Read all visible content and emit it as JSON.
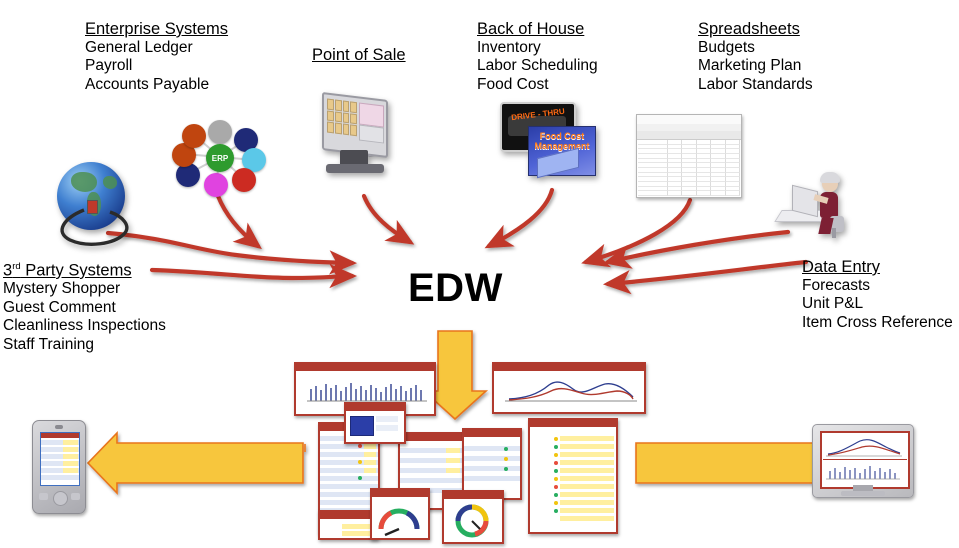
{
  "diagram": {
    "center_node": "EDW",
    "sources": [
      {
        "id": "enterprise-systems",
        "heading": "Enterprise Systems",
        "items": [
          "General Ledger",
          "Payroll",
          "Accounts Payable"
        ],
        "icon": "erp-bubble-chart-icon"
      },
      {
        "id": "point-of-sale",
        "heading": "Point of Sale",
        "items": [],
        "icon": "pos-terminal-icon"
      },
      {
        "id": "back-of-house",
        "heading": "Back of House",
        "items": [
          "Inventory",
          "Labor Scheduling",
          "Food Cost"
        ],
        "icon": "drive-thru-food-cost-icon"
      },
      {
        "id": "spreadsheets",
        "heading": "Spreadsheets",
        "items": [
          "Budgets",
          "Marketing Plan",
          "Labor Standards"
        ],
        "icon": "spreadsheet-window-icon"
      },
      {
        "id": "third-party-systems",
        "heading": "3rd Party Systems",
        "heading_prefix": "3",
        "heading_sup": "rd",
        "heading_rest": " Party Systems",
        "items": [
          "Mystery Shopper",
          "Guest Comment",
          "Cleanliness Inspections",
          "Staff Training"
        ],
        "icon": "globe-network-icon"
      },
      {
        "id": "data-entry",
        "heading": "Data Entry",
        "items": [
          "Forecasts",
          "Unit P&L",
          "Item Cross Reference"
        ],
        "icon": "person-at-computer-icon"
      }
    ],
    "outputs": [
      {
        "id": "handheld",
        "icon": "pda-handheld-icon"
      },
      {
        "id": "dashboards",
        "icon": "dashboard-reports-cluster-icon"
      },
      {
        "id": "desktop",
        "icon": "desktop-monitor-icon"
      }
    ],
    "icon_text": {
      "erp_hub": "ERP",
      "drive_thru": "DRIVE - THRU",
      "food_cost_line1": "Food Cost",
      "food_cost_line2": "Management"
    },
    "colors": {
      "inflow_arrow": "#c0392b",
      "outflow_arrow": "#f7c63e",
      "outflow_arrow_border": "#e8741c",
      "report_border": "#b03a2e",
      "text": "#000000",
      "background": "#ffffff"
    }
  }
}
